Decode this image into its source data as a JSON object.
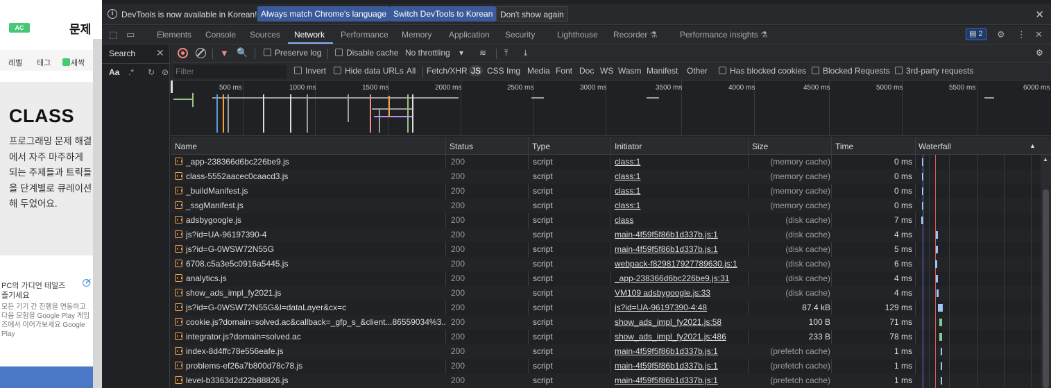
{
  "webpage": {
    "badge": "AC",
    "title": "문제",
    "nav": [
      "레벨",
      "태그",
      "새싹"
    ],
    "class_title": "CLASS",
    "class_desc": "프로그래밍 문제 해결에서 자주 마주하게 되는 주제들과 트릭들을 단계별로 큐레이션해 두었어요.",
    "ad_title": "PC의 가디언 테일즈",
    "ad_title2": "즐기세요",
    "ad_body": "모든 기기 간 진행을 연동하고 다음 모험을 Google Play 게임즈에서 이어가보세요 Google Play"
  },
  "infobar": {
    "text": "DevTools is now available in Korean!",
    "btn_match": "Always match Chrome's language",
    "btn_switch": "Switch DevTools to Korean",
    "btn_dismiss": "Don't show again"
  },
  "tabs": [
    "Elements",
    "Console",
    "Sources",
    "Network",
    "Performance",
    "Memory",
    "Application",
    "Security",
    "Lighthouse",
    "Recorder",
    "Performance insights"
  ],
  "issues_count": "2",
  "search_panel": {
    "label": "Search",
    "aa": "Aa",
    "regex": ".*"
  },
  "toolbar1": {
    "preserve_log": "Preserve log",
    "disable_cache": "Disable cache",
    "throttling": "No throttling"
  },
  "toolbar2": {
    "filter_placeholder": "Filter",
    "invert": "Invert",
    "hide_data_urls": "Hide data URLs",
    "types": [
      "All",
      "Fetch/XHR",
      "JS",
      "CSS",
      "Img",
      "Media",
      "Font",
      "Doc",
      "WS",
      "Wasm",
      "Manifest",
      "Other"
    ],
    "blocked_cookies": "Has blocked cookies",
    "blocked_requests": "Blocked Requests",
    "third_party": "3rd-party requests"
  },
  "overview_ticks": [
    "500 ms",
    "1000 ms",
    "1500 ms",
    "2000 ms",
    "2500 ms",
    "3000 ms",
    "3500 ms",
    "4000 ms",
    "4500 ms",
    "5000 ms",
    "5500 ms",
    "6000 ms"
  ],
  "columns": [
    "Name",
    "Status",
    "Type",
    "Initiator",
    "Size",
    "Time",
    "Waterfall"
  ],
  "rows": [
    {
      "name": "_app-238366d6bc226be9.js",
      "status": "200",
      "type": "script",
      "initiator": "class:1",
      "size": "(memory cache)",
      "time": "0 ms"
    },
    {
      "name": "class-5552aacec0caacd3.js",
      "status": "200",
      "type": "script",
      "initiator": "class:1",
      "size": "(memory cache)",
      "time": "0 ms"
    },
    {
      "name": "_buildManifest.js",
      "status": "200",
      "type": "script",
      "initiator": "class:1",
      "size": "(memory cache)",
      "time": "0 ms"
    },
    {
      "name": "_ssgManifest.js",
      "status": "200",
      "type": "script",
      "initiator": "class:1",
      "size": "(memory cache)",
      "time": "0 ms"
    },
    {
      "name": "adsbygoogle.js",
      "status": "200",
      "type": "script",
      "initiator": "class",
      "size": "(disk cache)",
      "time": "7 ms"
    },
    {
      "name": "js?id=UA-96197390-4",
      "status": "200",
      "type": "script",
      "initiator": "main-4f59f5f86b1d337b.js:1",
      "size": "(disk cache)",
      "time": "4 ms"
    },
    {
      "name": "js?id=G-0WSW72N55G",
      "status": "200",
      "type": "script",
      "initiator": "main-4f59f5f86b1d337b.js:1",
      "size": "(disk cache)",
      "time": "5 ms"
    },
    {
      "name": "6708.c5a3e5c0916a5445.js",
      "status": "200",
      "type": "script",
      "initiator": "webpack-f829817927789630.js:1",
      "size": "(disk cache)",
      "time": "6 ms"
    },
    {
      "name": "analytics.js",
      "status": "200",
      "type": "script",
      "initiator": "_app-238366d6bc226be9.js:31",
      "size": "(disk cache)",
      "time": "4 ms"
    },
    {
      "name": "show_ads_impl_fy2021.js",
      "status": "200",
      "type": "script",
      "initiator": "VM109 adsbygoogle.js:33",
      "size": "(disk cache)",
      "time": "4 ms"
    },
    {
      "name": "js?id=G-0WSW72N55G&l=dataLayer&cx=c",
      "status": "200",
      "type": "script",
      "initiator": "js?id=UA-96197390-4:48",
      "size": "87.4 kB",
      "time": "129 ms"
    },
    {
      "name": "cookie.js?domain=solved.ac&callback=_gfp_s_&client...86559034%3...",
      "status": "200",
      "type": "script",
      "initiator": "show_ads_impl_fy2021.js:58",
      "size": "100 B",
      "time": "71 ms"
    },
    {
      "name": "integrator.js?domain=solved.ac",
      "status": "200",
      "type": "script",
      "initiator": "show_ads_impl_fy2021.js:486",
      "size": "233 B",
      "time": "78 ms"
    },
    {
      "name": "index-8d4ffc78e556eafe.js",
      "status": "200",
      "type": "script",
      "initiator": "main-4f59f5f86b1d337b.js:1",
      "size": "(prefetch cache)",
      "time": "1 ms"
    },
    {
      "name": "problems-ef26a7b800d78c78.js",
      "status": "200",
      "type": "script",
      "initiator": "main-4f59f5f86b1d337b.js:1",
      "size": "(prefetch cache)",
      "time": "1 ms"
    },
    {
      "name": "level-b3363d2d22b88826.js",
      "status": "200",
      "type": "script",
      "initiator": "main-4f59f5f86b1d337b.js:1",
      "size": "(prefetch cache)",
      "time": "1 ms"
    }
  ],
  "colors": {
    "accent": "#8ab4f8",
    "record": "#f28b82",
    "js": "#f5a341",
    "ac_green": "#48c774"
  }
}
